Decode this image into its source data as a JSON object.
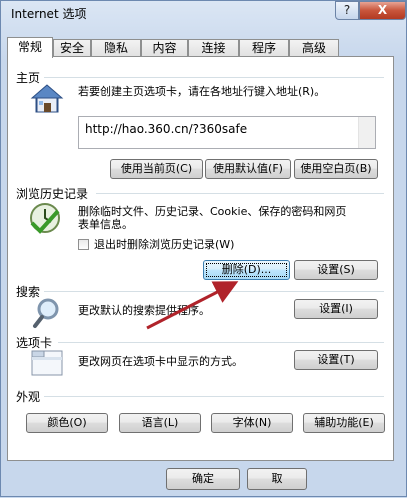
{
  "window": {
    "title": "Internet 选项",
    "help_label": "?",
    "close_label": "X"
  },
  "tabs": [
    "常规",
    "安全",
    "隐私",
    "内容",
    "连接",
    "程序",
    "高级"
  ],
  "home": {
    "group_label": "主页",
    "description": "若要创建主页选项卡，请在各地址行键入地址(R)。",
    "url": "http://hao.360.cn/?360safe",
    "btn_current": "使用当前页(C)",
    "btn_default": "使用默认值(F)",
    "btn_blank": "使用空白页(B)"
  },
  "history": {
    "group_label": "浏览历史记录",
    "description_line1": "删除临时文件、历史记录、Cookie、保存的密码和网页",
    "description_line2": "表单信息。",
    "checkbox_label": "退出时删除浏览历史记录(W)",
    "btn_delete": "删除(D)...",
    "btn_settings": "设置(S)"
  },
  "search": {
    "group_label": "搜索",
    "description": "更改默认的搜索提供程序。",
    "btn_settings": "设置(I)"
  },
  "tabs_group": {
    "group_label": "选项卡",
    "description": "更改网页在选项卡中显示的方式。",
    "btn_settings": "设置(T)"
  },
  "appearance": {
    "group_label": "外观",
    "btn_colors": "颜色(O)",
    "btn_languages": "语言(L)",
    "btn_fonts": "字体(N)",
    "btn_accessibility": "辅助功能(E)"
  },
  "footer": {
    "ok": "确定",
    "cancel": "取"
  },
  "colors": {
    "arrow": "#b0232a",
    "focus_border": "#3c7fb1"
  }
}
